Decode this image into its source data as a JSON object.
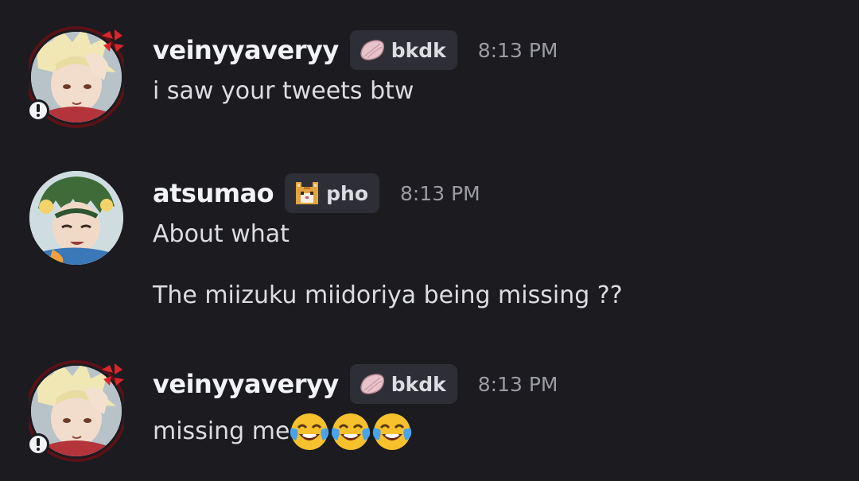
{
  "messages": [
    {
      "username": "veinyyaveryy",
      "tag": {
        "label": "bkdk",
        "icon": "sakura-petal-icon"
      },
      "time": "8:13 PM",
      "lines": [
        "i saw your tweets btw"
      ]
    },
    {
      "username": "atsumao",
      "tag": {
        "label": "pho",
        "icon": "cat-face-icon"
      },
      "time": "8:13 PM",
      "lines": [
        "About what",
        "The miizuku miidoriya being missing ??"
      ]
    },
    {
      "username": "veinyyaveryy",
      "tag": {
        "label": "bkdk",
        "icon": "sakura-petal-icon"
      },
      "time": "8:13 PM",
      "lines": [
        "missing me"
      ],
      "emojis": [
        "face-with-tears-of-joy",
        "face-with-tears-of-joy",
        "face-with-tears-of-joy"
      ]
    }
  ],
  "colors": {
    "background": "#1b1b20",
    "username": "#f2f3f5",
    "text": "#dcdde1",
    "timestamp": "#9b9ca3",
    "tag_background": "#2e2f36"
  }
}
